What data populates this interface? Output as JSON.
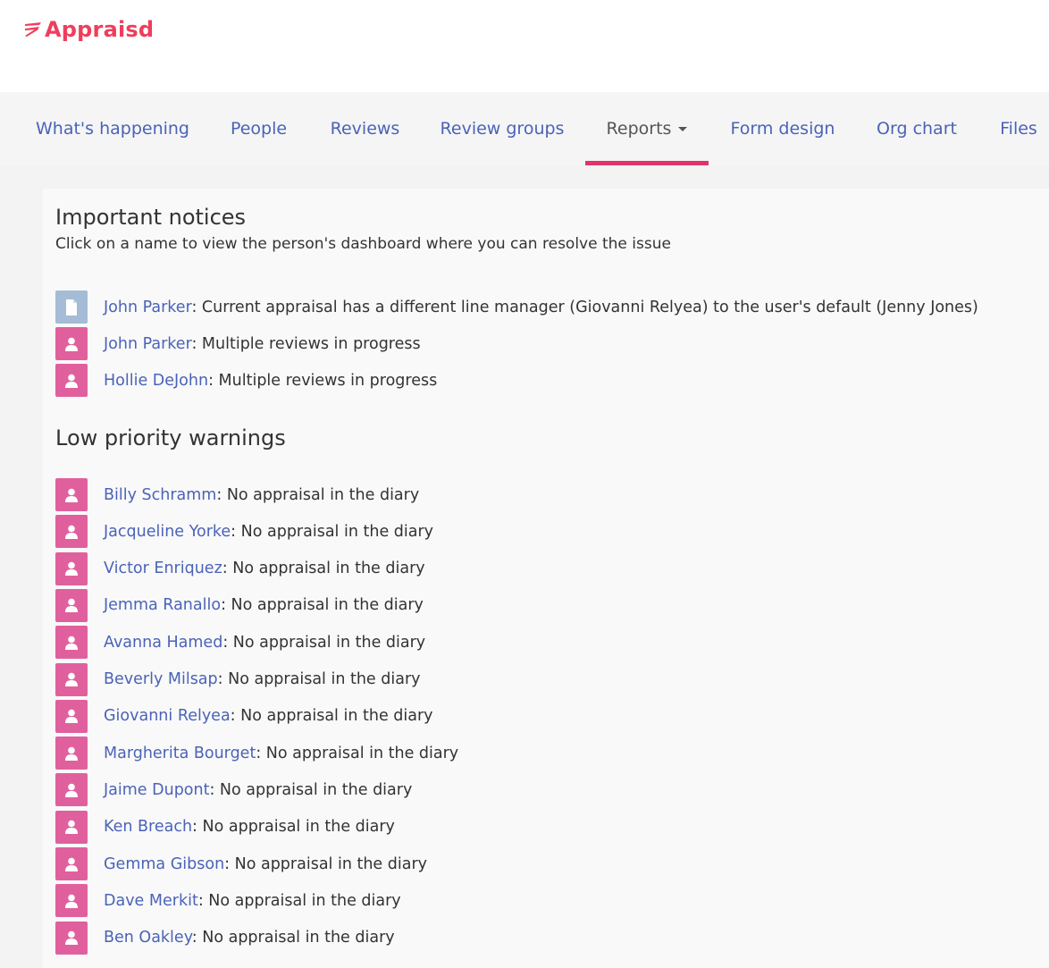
{
  "brand": {
    "name": "Appraisd",
    "color": "#ef3e5c"
  },
  "nav": {
    "items": [
      {
        "label": "What's happening"
      },
      {
        "label": "People"
      },
      {
        "label": "Reviews"
      },
      {
        "label": "Review groups"
      },
      {
        "label": "Reports",
        "active": true,
        "dropdown": true
      },
      {
        "label": "Form design"
      },
      {
        "label": "Org chart"
      },
      {
        "label": "Files"
      }
    ]
  },
  "notices": {
    "title": "Important notices",
    "subtitle": "Click on a name to view the person's dashboard where you can resolve the issue",
    "items": [
      {
        "icon": "document-icon",
        "name": "John Parker",
        "message": ": Current appraisal has a different line manager (Giovanni Relyea) to the user's default (Jenny Jones)"
      },
      {
        "icon": "person-icon",
        "name": "John Parker",
        "message": ": Multiple reviews in progress"
      },
      {
        "icon": "person-icon",
        "name": "Hollie DeJohn",
        "message": ": Multiple reviews in progress"
      }
    ]
  },
  "warnings": {
    "title": "Low priority warnings",
    "items": [
      {
        "icon": "person-icon",
        "name": "Billy Schramm",
        "message": ": No appraisal in the diary"
      },
      {
        "icon": "person-icon",
        "name": "Jacqueline Yorke",
        "message": ": No appraisal in the diary"
      },
      {
        "icon": "person-icon",
        "name": "Victor Enriquez",
        "message": ": No appraisal in the diary"
      },
      {
        "icon": "person-icon",
        "name": "Jemma Ranallo",
        "message": ": No appraisal in the diary"
      },
      {
        "icon": "person-icon",
        "name": "Avanna Hamed",
        "message": ": No appraisal in the diary"
      },
      {
        "icon": "person-icon",
        "name": "Beverly Milsap",
        "message": ": No appraisal in the diary"
      },
      {
        "icon": "person-icon",
        "name": "Giovanni Relyea",
        "message": ": No appraisal in the diary"
      },
      {
        "icon": "person-icon",
        "name": "Margherita Bourget",
        "message": ": No appraisal in the diary"
      },
      {
        "icon": "person-icon",
        "name": "Jaime Dupont",
        "message": ": No appraisal in the diary"
      },
      {
        "icon": "person-icon",
        "name": "Ken Breach",
        "message": ": No appraisal in the diary"
      },
      {
        "icon": "person-icon",
        "name": "Gemma Gibson",
        "message": ": No appraisal in the diary"
      },
      {
        "icon": "person-icon",
        "name": "Dave Merkit",
        "message": ": No appraisal in the diary"
      },
      {
        "icon": "person-icon",
        "name": "Ben Oakley",
        "message": ": No appraisal in the diary"
      }
    ]
  },
  "colors": {
    "link": "#4a63b8",
    "person_icon_bg": "#e0609e",
    "document_icon_bg": "#a4bcd6",
    "active_tab_underline": "#e0336a"
  }
}
